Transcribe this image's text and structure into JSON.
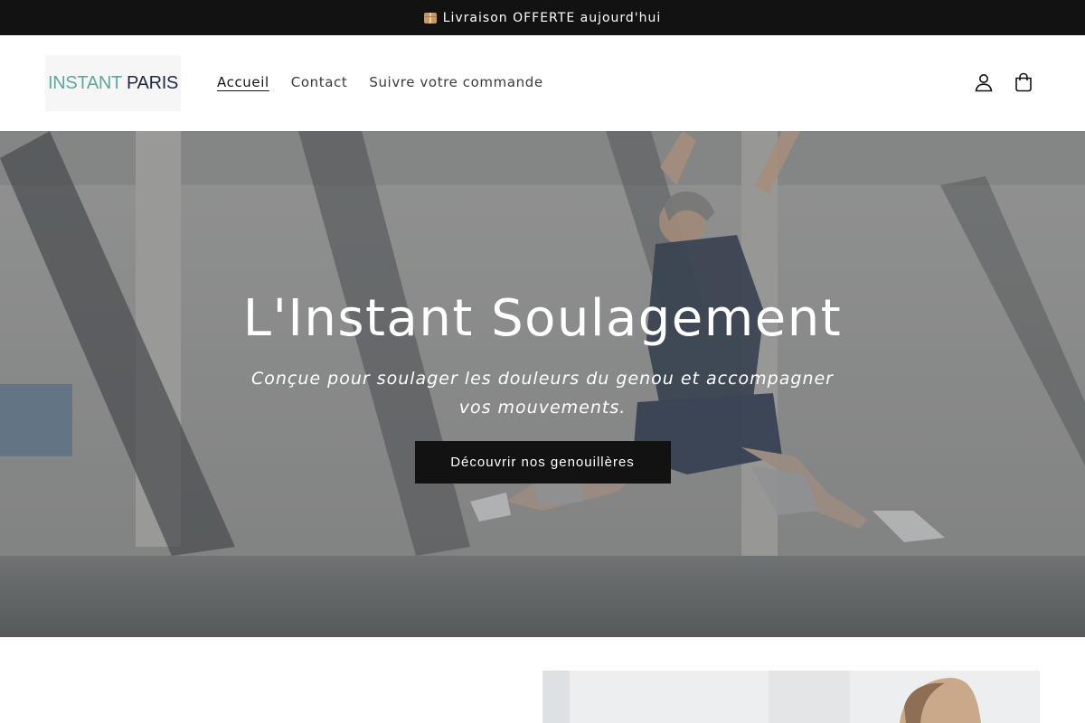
{
  "announcement": {
    "icon": "package-icon",
    "text": "Livraison OFFERTE aujourd'hui"
  },
  "header": {
    "logo": {
      "part1": "INSTANT",
      "part2": "PARIS"
    },
    "nav": [
      {
        "label": "Accueil",
        "active": true
      },
      {
        "label": "Contact",
        "active": false
      },
      {
        "label": "Suivre votre commande",
        "active": false
      }
    ],
    "icons": [
      "account-icon",
      "cart-icon"
    ]
  },
  "hero": {
    "title": "L'Instant Soulagement",
    "subtitle": "Conçue pour soulager les douleurs du genou et accompagner vos mouvements.",
    "button_label": "Découvrir nos genouillères"
  },
  "colors": {
    "announcement_bg": "#121212",
    "button_bg": "#121212",
    "logo_accent": "#5fa89b",
    "logo_dark": "#1f2a44"
  }
}
